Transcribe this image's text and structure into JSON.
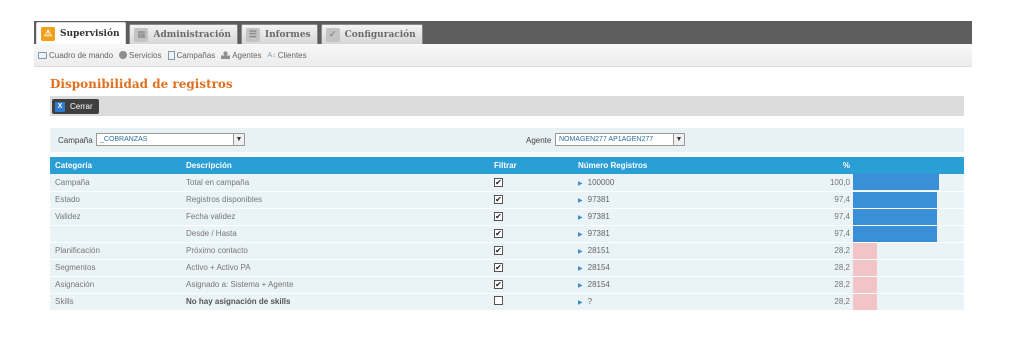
{
  "tabs": [
    {
      "label": "Supervisión",
      "icon": "warning-icon",
      "active": true
    },
    {
      "label": "Administración",
      "icon": "building-icon",
      "active": false
    },
    {
      "label": "Informes",
      "icon": "report-icon",
      "active": false
    },
    {
      "label": "Configuración",
      "icon": "wrench-icon",
      "active": false
    }
  ],
  "subnav": [
    {
      "label": "Cuadro de mando",
      "icon": "monitor-icon"
    },
    {
      "label": "Servicios",
      "icon": "gear-icon"
    },
    {
      "label": "Campañas",
      "icon": "document-icon"
    },
    {
      "label": "Agentes",
      "icon": "person-icon"
    },
    {
      "label": "Clientes",
      "icon": "az-icon"
    }
  ],
  "page": {
    "title": "Disponibilidad de registros"
  },
  "toolbar": {
    "close_label": "Cerrar",
    "close_icon_glyph": "X"
  },
  "filters": {
    "campaign_label": "Campaña",
    "campaign_value": "_COBRANZAS",
    "agent_label": "Agente",
    "agent_value": "NOMAGEN277 AP1AGEN277"
  },
  "table": {
    "headers": {
      "categoria": "Categoría",
      "descripcion": "Descripción",
      "filtrar": "Filtrar",
      "numero": "Número Registros",
      "pct": "%"
    },
    "rows": [
      {
        "categoria": "Campaña",
        "descripcion": "Total en campaña",
        "checked": true,
        "numero": "100000",
        "pct": "100,0",
        "pct_value": 100,
        "bar_color": "#3a8fd6",
        "bold": false
      },
      {
        "categoria": "Estado",
        "descripcion": "Registros disponibles",
        "checked": true,
        "numero": "97381",
        "pct": "97,4",
        "pct_value": 97.4,
        "bar_color": "#3a8fd6",
        "bold": false
      },
      {
        "categoria": "Validez",
        "descripcion": "Fecha validez",
        "checked": true,
        "numero": "97381",
        "pct": "97,4",
        "pct_value": 97.4,
        "bar_color": "#3a8fd6",
        "bold": false
      },
      {
        "categoria": "",
        "descripcion": "Desde / Hasta",
        "checked": true,
        "numero": "97381",
        "pct": "97,4",
        "pct_value": 97.4,
        "bar_color": "#3a8fd6",
        "bold": false
      },
      {
        "categoria": "Planificación",
        "descripcion": "Próximo contacto",
        "checked": true,
        "numero": "28151",
        "pct": "28,2",
        "pct_value": 28.2,
        "bar_color": "#f2c4c6",
        "bold": false
      },
      {
        "categoria": "Segmentos",
        "descripcion": "Activo + Activo PA",
        "checked": true,
        "numero": "28154",
        "pct": "28,2",
        "pct_value": 28.2,
        "bar_color": "#f2c4c6",
        "bold": false
      },
      {
        "categoria": "Asignación",
        "descripcion": "Asignado a: Sistema + Agente",
        "checked": true,
        "numero": "28154",
        "pct": "28,2",
        "pct_value": 28.2,
        "bar_color": "#f2c4c6",
        "bold": false
      },
      {
        "categoria": "Skills",
        "descripcion": "No hay asignación de skills",
        "checked": false,
        "numero": "?",
        "pct": "28,2",
        "pct_value": 28.2,
        "bar_color": "#f2c4c6",
        "bold": true
      }
    ]
  }
}
